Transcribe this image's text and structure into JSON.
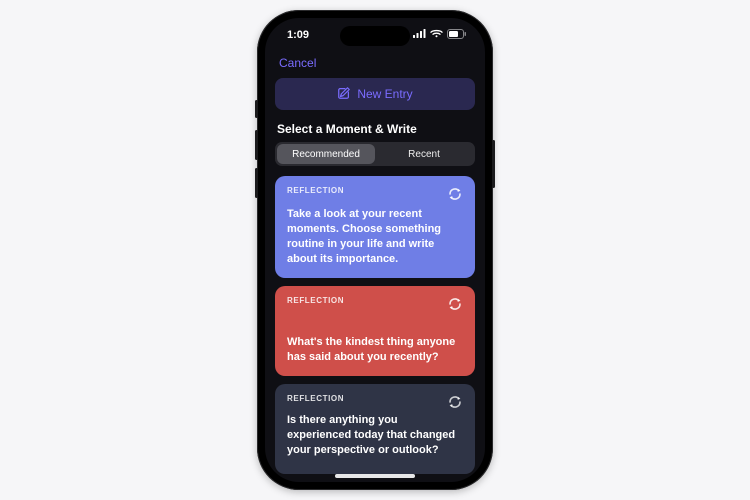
{
  "status": {
    "time": "1:09"
  },
  "nav": {
    "cancel": "Cancel"
  },
  "new_entry_label": "New Entry",
  "heading": "Select a Moment & Write",
  "segments": {
    "recommended": "Recommended",
    "recent": "Recent"
  },
  "cards": [
    {
      "category": "REFLECTION",
      "prompt": "Take a look at your recent moments. Choose something routine in your life and write about its importance."
    },
    {
      "category": "REFLECTION",
      "prompt": "What's the kindest thing anyone has said about you recently?"
    },
    {
      "category": "REFLECTION",
      "prompt": "Is there anything you experienced today that changed your perspective or outlook?"
    }
  ]
}
